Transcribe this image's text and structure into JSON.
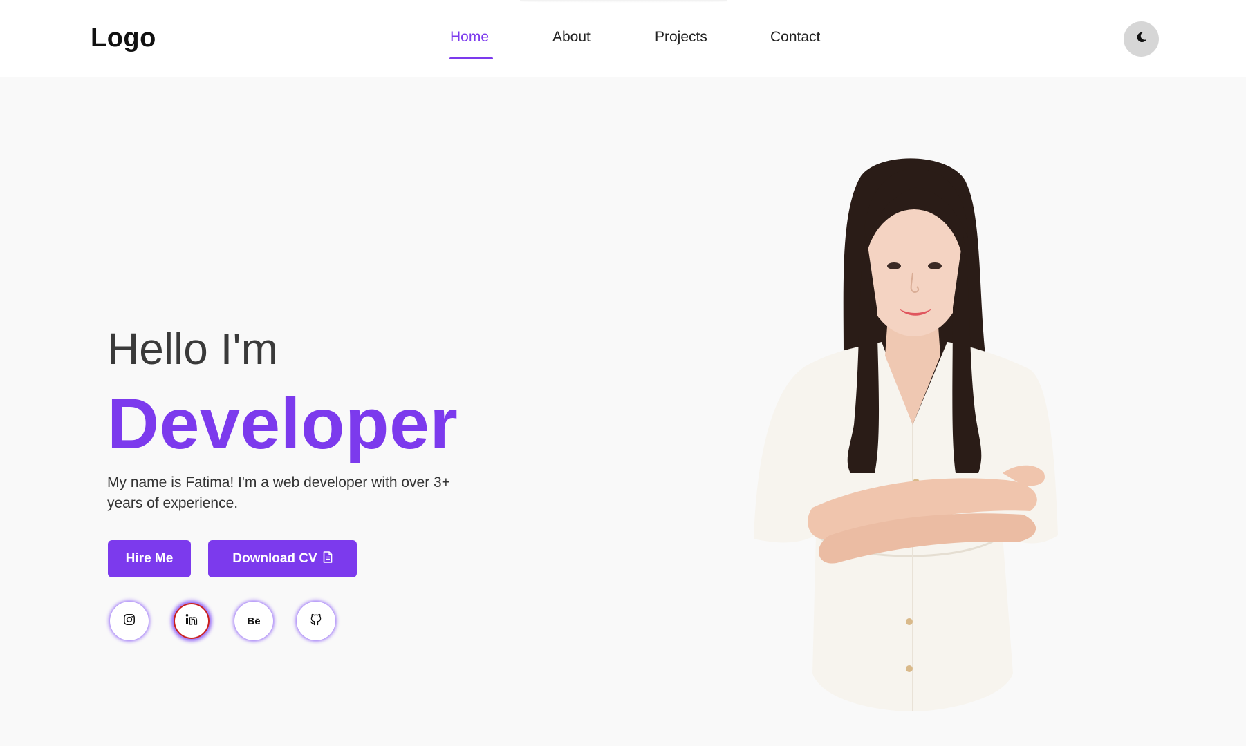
{
  "header": {
    "logo": "Logo",
    "nav": [
      {
        "label": "Home",
        "active": true
      },
      {
        "label": "About",
        "active": false
      },
      {
        "label": "Projects",
        "active": false
      },
      {
        "label": "Contact",
        "active": false
      }
    ],
    "theme_toggle_icon": "moon-icon"
  },
  "hero": {
    "greeting": "Hello I'm",
    "role": "Developer",
    "intro": "My name is Fatima! I'm a web developer with over 3+ years of experience.",
    "buttons": {
      "hire_label": "Hire Me",
      "cv_label": "Download CV",
      "cv_icon": "file-icon"
    },
    "socials": [
      {
        "name": "instagram-icon"
      },
      {
        "name": "linkedin-icon"
      },
      {
        "name": "behance-icon",
        "text": "Bē"
      },
      {
        "name": "github-icon"
      }
    ],
    "portrait": "woman-portrait-photo"
  },
  "colors": {
    "accent": "#7c3aed",
    "background": "#f9f9f9",
    "header_bg": "#ffffff",
    "toggle_bg": "#d6d6d6"
  }
}
